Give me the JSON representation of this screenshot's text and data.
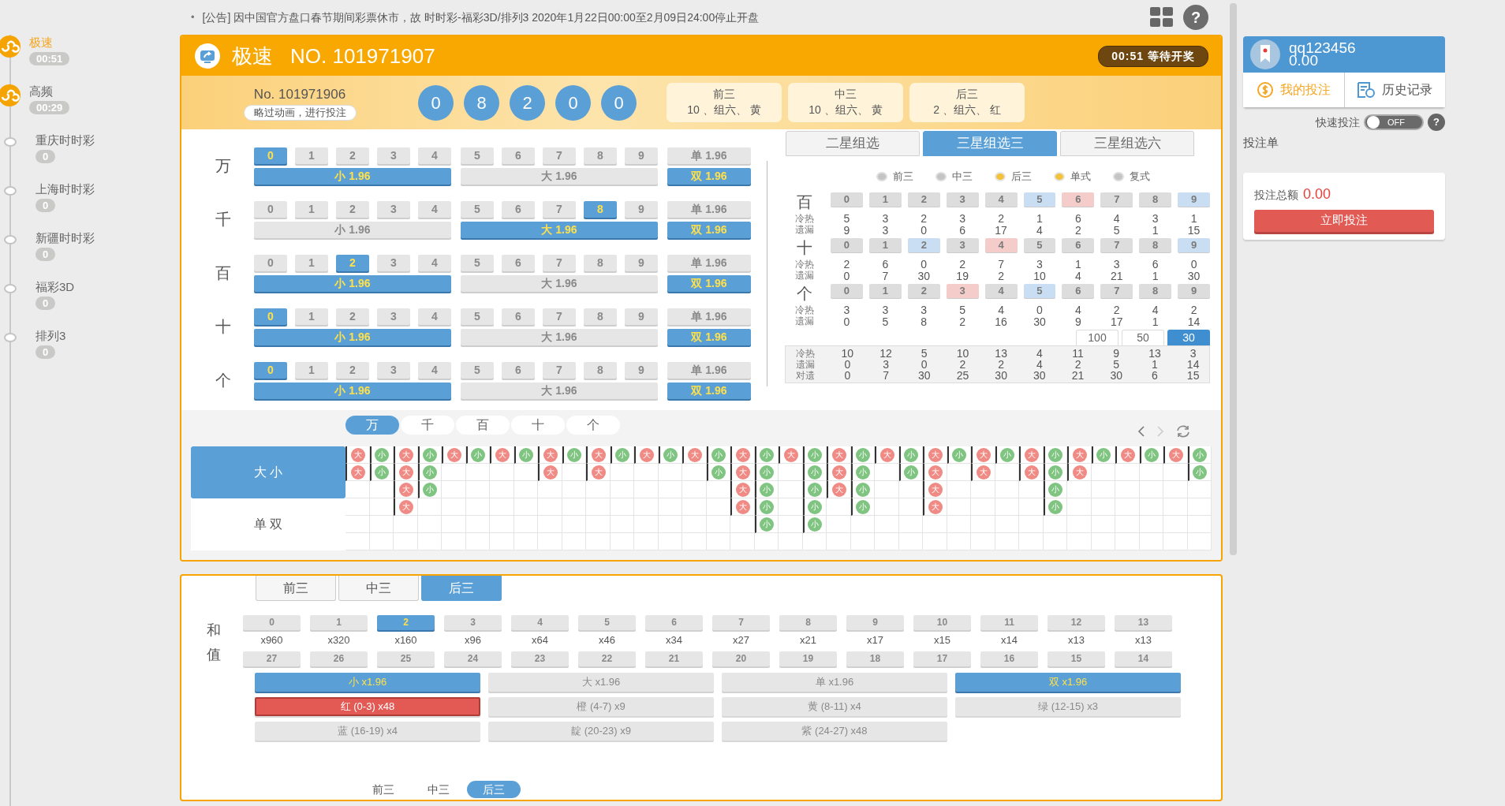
{
  "notice_bullet": "•",
  "notice": "[公告] 因中国官方盘口春节期间彩票休市，故 时时彩-福彩3D/排列3 2020年1月22日00:00至2月09日24:00停止开盘",
  "help_label": "?",
  "sidebar": [
    {
      "name": "极速",
      "timer": "00:51",
      "kind": "badge",
      "selected": true
    },
    {
      "name": "高频",
      "timer": "00:29",
      "kind": "badge",
      "selected": false
    },
    {
      "name": "重庆时时彩",
      "timer": "0",
      "kind": "dot",
      "selected": false
    },
    {
      "name": "上海时时彩",
      "timer": "0",
      "kind": "dot",
      "selected": false
    },
    {
      "name": "新疆时时彩",
      "timer": "0",
      "kind": "dot",
      "selected": false
    },
    {
      "name": "福彩3D",
      "timer": "0",
      "kind": "dot",
      "selected": false
    },
    {
      "name": "排列3",
      "timer": "0",
      "kind": "dot",
      "selected": false
    }
  ],
  "game": {
    "title": "极速",
    "issue": "NO. 101971907",
    "status": "00:51 等待开奖"
  },
  "last_draw": {
    "issue": "No. 101971906",
    "skip_button": "略过动画，进行投注",
    "balls": [
      "0",
      "8",
      "2",
      "0",
      "0"
    ],
    "groups": [
      {
        "name": "前三",
        "result": "10 、组六、 黄"
      },
      {
        "name": "中三",
        "result": "10 、组六、 黄"
      },
      {
        "name": "后三",
        "result": "2 、组六、 红"
      }
    ]
  },
  "positions": [
    {
      "label": "万",
      "digits": [
        {
          "label": "0",
          "selected": true
        },
        {
          "label": "1",
          "selected": false
        },
        {
          "label": "2",
          "selected": false
        },
        {
          "label": "3",
          "selected": false
        },
        {
          "label": "4",
          "selected": false
        },
        {
          "label": "5",
          "selected": false
        },
        {
          "label": "6",
          "selected": false
        },
        {
          "label": "7",
          "selected": false
        },
        {
          "label": "8",
          "selected": false
        },
        {
          "label": "9",
          "selected": false
        }
      ],
      "small": {
        "label": "小 1.96",
        "selected": true
      },
      "big": {
        "label": "大 1.96",
        "selected": false
      },
      "odd": {
        "label": "单 1.96",
        "selected": false
      },
      "even": {
        "label": "双 1.96",
        "selected": true
      }
    },
    {
      "label": "千",
      "digits": [
        {
          "label": "0",
          "selected": false
        },
        {
          "label": "1",
          "selected": false
        },
        {
          "label": "2",
          "selected": false
        },
        {
          "label": "3",
          "selected": false
        },
        {
          "label": "4",
          "selected": false
        },
        {
          "label": "5",
          "selected": false
        },
        {
          "label": "6",
          "selected": false
        },
        {
          "label": "7",
          "selected": false
        },
        {
          "label": "8",
          "selected": true
        },
        {
          "label": "9",
          "selected": false
        }
      ],
      "small": {
        "label": "小 1.96",
        "selected": false
      },
      "big": {
        "label": "大 1.96",
        "selected": true
      },
      "odd": {
        "label": "单 1.96",
        "selected": false
      },
      "even": {
        "label": "双 1.96",
        "selected": true
      }
    },
    {
      "label": "百",
      "digits": [
        {
          "label": "0",
          "selected": false
        },
        {
          "label": "1",
          "selected": false
        },
        {
          "label": "2",
          "selected": true
        },
        {
          "label": "3",
          "selected": false
        },
        {
          "label": "4",
          "selected": false
        },
        {
          "label": "5",
          "selected": false
        },
        {
          "label": "6",
          "selected": false
        },
        {
          "label": "7",
          "selected": false
        },
        {
          "label": "8",
          "selected": false
        },
        {
          "label": "9",
          "selected": false
        }
      ],
      "small": {
        "label": "小 1.96",
        "selected": true
      },
      "big": {
        "label": "大 1.96",
        "selected": false
      },
      "odd": {
        "label": "单 1.96",
        "selected": false
      },
      "even": {
        "label": "双 1.96",
        "selected": true
      }
    },
    {
      "label": "十",
      "digits": [
        {
          "label": "0",
          "selected": true
        },
        {
          "label": "1",
          "selected": false
        },
        {
          "label": "2",
          "selected": false
        },
        {
          "label": "3",
          "selected": false
        },
        {
          "label": "4",
          "selected": false
        },
        {
          "label": "5",
          "selected": false
        },
        {
          "label": "6",
          "selected": false
        },
        {
          "label": "7",
          "selected": false
        },
        {
          "label": "8",
          "selected": false
        },
        {
          "label": "9",
          "selected": false
        }
      ],
      "small": {
        "label": "小 1.96",
        "selected": true
      },
      "big": {
        "label": "大 1.96",
        "selected": false
      },
      "odd": {
        "label": "单 1.96",
        "selected": false
      },
      "even": {
        "label": "双 1.96",
        "selected": true
      }
    },
    {
      "label": "个",
      "digits": [
        {
          "label": "0",
          "selected": true
        },
        {
          "label": "1",
          "selected": false
        },
        {
          "label": "2",
          "selected": false
        },
        {
          "label": "3",
          "selected": false
        },
        {
          "label": "4",
          "selected": false
        },
        {
          "label": "5",
          "selected": false
        },
        {
          "label": "6",
          "selected": false
        },
        {
          "label": "7",
          "selected": false
        },
        {
          "label": "8",
          "selected": false
        },
        {
          "label": "9",
          "selected": false
        }
      ],
      "small": {
        "label": "小 1.96",
        "selected": true
      },
      "big": {
        "label": "大 1.96",
        "selected": false
      },
      "odd": {
        "label": "单 1.96",
        "selected": false
      },
      "even": {
        "label": "双 1.96",
        "selected": true
      }
    }
  ],
  "combo_tabs": [
    {
      "label": "二星组选",
      "selected": false
    },
    {
      "label": "三星组选三",
      "selected": true
    },
    {
      "label": "三星组选六",
      "selected": false
    }
  ],
  "combo_options": [
    {
      "label": "前三",
      "checked": false
    },
    {
      "label": "中三",
      "checked": false
    },
    {
      "label": "后三",
      "checked": true
    },
    {
      "label": "单式",
      "checked": true
    },
    {
      "label": "复式",
      "checked": false
    }
  ],
  "stats": [
    {
      "label": "百",
      "hot_label": "冷热",
      "miss_label": "遗漏",
      "digits": [
        {
          "label": "0",
          "color": "#dddddd"
        },
        {
          "label": "1",
          "color": "#dddddd"
        },
        {
          "label": "2",
          "color": "#dddddd"
        },
        {
          "label": "3",
          "color": "#dddddd"
        },
        {
          "label": "4",
          "color": "#dddddd"
        },
        {
          "label": "5",
          "color": "#c9def3"
        },
        {
          "label": "6",
          "color": "#f4cdca"
        },
        {
          "label": "7",
          "color": "#dddddd"
        },
        {
          "label": "8",
          "color": "#dddddd"
        },
        {
          "label": "9",
          "color": "#c9def3"
        }
      ],
      "hot": [
        "5",
        "3",
        "2",
        "3",
        "2",
        "1",
        "6",
        "4",
        "3",
        "1"
      ],
      "miss": [
        "9",
        "3",
        "0",
        "6",
        "17",
        "4",
        "2",
        "5",
        "1",
        "15"
      ]
    },
    {
      "label": "十",
      "hot_label": "冷热",
      "miss_label": "遗漏",
      "digits": [
        {
          "label": "0",
          "color": "#dddddd"
        },
        {
          "label": "1",
          "color": "#dddddd"
        },
        {
          "label": "2",
          "color": "#c9def3"
        },
        {
          "label": "3",
          "color": "#dddddd"
        },
        {
          "label": "4",
          "color": "#f4cdca"
        },
        {
          "label": "5",
          "color": "#dddddd"
        },
        {
          "label": "6",
          "color": "#dddddd"
        },
        {
          "label": "7",
          "color": "#dddddd"
        },
        {
          "label": "8",
          "color": "#dddddd"
        },
        {
          "label": "9",
          "color": "#c9def3"
        }
      ],
      "hot": [
        "2",
        "6",
        "0",
        "2",
        "7",
        "3",
        "1",
        "3",
        "6",
        "0"
      ],
      "miss": [
        "0",
        "7",
        "30",
        "19",
        "2",
        "10",
        "4",
        "21",
        "1",
        "30"
      ]
    },
    {
      "label": "个",
      "hot_label": "冷热",
      "miss_label": "遗漏",
      "digits": [
        {
          "label": "0",
          "color": "#dddddd"
        },
        {
          "label": "1",
          "color": "#dddddd"
        },
        {
          "label": "2",
          "color": "#dddddd"
        },
        {
          "label": "3",
          "color": "#f4cdca"
        },
        {
          "label": "4",
          "color": "#dddddd"
        },
        {
          "label": "5",
          "color": "#c9def3"
        },
        {
          "label": "6",
          "color": "#dddddd"
        },
        {
          "label": "7",
          "color": "#dddddd"
        },
        {
          "label": "8",
          "color": "#dddddd"
        },
        {
          "label": "9",
          "color": "#dddddd"
        }
      ],
      "hot": [
        "3",
        "3",
        "3",
        "5",
        "4",
        "0",
        "4",
        "2",
        "4",
        "2"
      ],
      "miss": [
        "0",
        "5",
        "8",
        "2",
        "16",
        "30",
        "9",
        "17",
        "1",
        "14"
      ]
    }
  ],
  "periods": [
    {
      "label": "100",
      "selected": false
    },
    {
      "label": "50",
      "selected": false
    },
    {
      "label": "30",
      "selected": true
    }
  ],
  "summary": [
    {
      "label": "冷热",
      "values": [
        "10",
        "12",
        "5",
        "10",
        "13",
        "4",
        "11",
        "9",
        "13",
        "3"
      ]
    },
    {
      "label": "遗漏",
      "values": [
        "0",
        "3",
        "0",
        "2",
        "2",
        "4",
        "2",
        "5",
        "1",
        "14"
      ]
    },
    {
      "label": "对遗",
      "values": [
        "0",
        "7",
        "30",
        "25",
        "30",
        "30",
        "21",
        "30",
        "6",
        "15"
      ]
    }
  ],
  "trend": {
    "position_tabs": [
      {
        "label": "万",
        "selected": true
      },
      {
        "label": "千",
        "selected": false
      },
      {
        "label": "百",
        "selected": false
      },
      {
        "label": "十",
        "selected": false
      },
      {
        "label": "个",
        "selected": false
      }
    ],
    "categories": [
      {
        "label": "大 小",
        "selected": true
      },
      {
        "label": "单 双",
        "selected": false
      }
    ],
    "columns": [
      {
        "kind": "big",
        "marks": [
          "大",
          "大"
        ]
      },
      {
        "kind": "small",
        "marks": [
          "小",
          "小"
        ]
      },
      {
        "kind": "big",
        "marks": [
          "大",
          "大",
          "大",
          "大"
        ]
      },
      {
        "kind": "small",
        "marks": [
          "小",
          "小",
          "小"
        ]
      },
      {
        "kind": "big",
        "marks": [
          "大"
        ]
      },
      {
        "kind": "small",
        "marks": [
          "小"
        ]
      },
      {
        "kind": "big",
        "marks": [
          "大"
        ]
      },
      {
        "kind": "small",
        "marks": [
          "小"
        ]
      },
      {
        "kind": "big",
        "marks": [
          "大",
          "大"
        ]
      },
      {
        "kind": "small",
        "marks": [
          "小"
        ]
      },
      {
        "kind": "big",
        "marks": [
          "大",
          "大"
        ]
      },
      {
        "kind": "small",
        "marks": [
          "小"
        ]
      },
      {
        "kind": "big",
        "marks": [
          "大"
        ]
      },
      {
        "kind": "small",
        "marks": [
          "小"
        ]
      },
      {
        "kind": "big",
        "marks": [
          "大"
        ]
      },
      {
        "kind": "small",
        "marks": [
          "小",
          "小"
        ]
      },
      {
        "kind": "big",
        "marks": [
          "大",
          "大",
          "大",
          "大"
        ]
      },
      {
        "kind": "small",
        "marks": [
          "小",
          "小",
          "小",
          "小",
          "小"
        ]
      },
      {
        "kind": "big",
        "marks": [
          "大"
        ]
      },
      {
        "kind": "small",
        "marks": [
          "小",
          "小",
          "小",
          "小",
          "小"
        ]
      },
      {
        "kind": "big",
        "marks": [
          "大",
          "大",
          "大"
        ]
      },
      {
        "kind": "small",
        "marks": [
          "小",
          "小",
          "小",
          "小"
        ]
      },
      {
        "kind": "big",
        "marks": [
          "大"
        ]
      },
      {
        "kind": "small",
        "marks": [
          "小",
          "小"
        ]
      },
      {
        "kind": "big",
        "marks": [
          "大",
          "大",
          "大",
          "大"
        ]
      },
      {
        "kind": "small",
        "marks": [
          "小"
        ]
      },
      {
        "kind": "big",
        "marks": [
          "大",
          "大"
        ]
      },
      {
        "kind": "small",
        "marks": [
          "小"
        ]
      },
      {
        "kind": "big",
        "marks": [
          "大",
          "大"
        ]
      },
      {
        "kind": "small",
        "marks": [
          "小",
          "小",
          "小",
          "小"
        ]
      },
      {
        "kind": "big",
        "marks": [
          "大",
          "大"
        ]
      },
      {
        "kind": "small",
        "marks": [
          "小"
        ]
      },
      {
        "kind": "big",
        "marks": [
          "大"
        ]
      },
      {
        "kind": "small",
        "marks": [
          "小"
        ]
      },
      {
        "kind": "big",
        "marks": [
          "大"
        ]
      },
      {
        "kind": "small",
        "marks": [
          "小",
          "小"
        ]
      }
    ]
  },
  "sum_tabs": [
    {
      "label": "前三",
      "selected": false
    },
    {
      "label": "中三",
      "selected": false
    },
    {
      "label": "后三",
      "selected": true
    }
  ],
  "sum_label": "和值",
  "sums": [
    {
      "label": "0",
      "odds": "x960",
      "selected": false
    },
    {
      "label": "1",
      "odds": "x320",
      "selected": false
    },
    {
      "label": "2",
      "odds": "x160",
      "selected": true
    },
    {
      "label": "3",
      "odds": "x96",
      "selected": false
    },
    {
      "label": "4",
      "odds": "x64",
      "selected": false
    },
    {
      "label": "5",
      "odds": "x46",
      "selected": false
    },
    {
      "label": "6",
      "odds": "x34",
      "selected": false
    },
    {
      "label": "7",
      "odds": "x27",
      "selected": false
    },
    {
      "label": "8",
      "odds": "x21",
      "selected": false
    },
    {
      "label": "9",
      "odds": "x17",
      "selected": false
    },
    {
      "label": "10",
      "odds": "x15",
      "selected": false
    },
    {
      "label": "11",
      "odds": "x14",
      "selected": false
    },
    {
      "label": "12",
      "odds": "x13",
      "selected": false
    },
    {
      "label": "13",
      "odds": "x13",
      "selected": false
    }
  ],
  "sums_high": [
    {
      "label": "27",
      "selected": false
    },
    {
      "label": "26",
      "selected": false
    },
    {
      "label": "25",
      "selected": false
    },
    {
      "label": "24",
      "selected": false
    },
    {
      "label": "23",
      "selected": false
    },
    {
      "label": "22",
      "selected": false
    },
    {
      "label": "21",
      "selected": false
    },
    {
      "label": "20",
      "selected": false
    },
    {
      "label": "19",
      "selected": false
    },
    {
      "label": "18",
      "selected": false
    },
    {
      "label": "17",
      "selected": false
    },
    {
      "label": "16",
      "selected": false
    },
    {
      "label": "15",
      "selected": false
    },
    {
      "label": "14",
      "selected": false
    }
  ],
  "sum_options": [
    {
      "label": "小 x1.96",
      "kind": "size",
      "selected": true
    },
    {
      "label": "大 x1.96",
      "kind": "size",
      "selected": false
    },
    {
      "label": "单 x1.96",
      "kind": "size",
      "selected": false
    },
    {
      "label": "双 x1.96",
      "kind": "size",
      "selected": true
    },
    {
      "label": "红 (0-3) x48",
      "kind": "color",
      "selected": true
    },
    {
      "label": "橙 (4-7) x9",
      "kind": "color",
      "selected": false
    },
    {
      "label": "黄 (8-11) x4",
      "kind": "color",
      "selected": false
    },
    {
      "label": "绿 (12-15) x3",
      "kind": "color",
      "selected": false
    },
    {
      "label": "蓝 (16-19) x4",
      "kind": "color",
      "selected": false
    },
    {
      "label": "靛 (20-23) x9",
      "kind": "color",
      "selected": false
    },
    {
      "label": "紫 (24-27) x48",
      "kind": "color",
      "selected": false
    }
  ],
  "lower_tabs": [
    {
      "label": "前三",
      "selected": false
    },
    {
      "label": "中三",
      "selected": false
    },
    {
      "label": "后三",
      "selected": true
    }
  ],
  "user": {
    "name": "qq123456",
    "balance": "0.00"
  },
  "user_links": [
    {
      "label": "我的投注",
      "kind": "bets"
    },
    {
      "label": "历史记录",
      "kind": "history"
    }
  ],
  "quick_bet": {
    "label": "快速投注",
    "on": false,
    "off_text": "OFF",
    "help": "?"
  },
  "slip": {
    "title": "投注单",
    "total_label": "投注总额",
    "total": "0.00",
    "submit": "立即投注"
  }
}
